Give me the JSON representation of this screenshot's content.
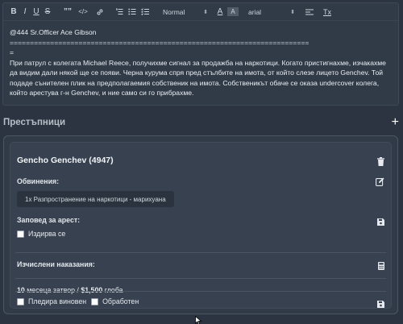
{
  "toolbar": {
    "bold": "B",
    "italic": "I",
    "underline": "U",
    "strike": "S",
    "quote": "””",
    "code": "</>",
    "heading_select": "Normal",
    "font_select": "arial",
    "text_color": "A",
    "bg_color": "A",
    "clear_format": "Tx"
  },
  "editor": {
    "line1": "@444 Sr.Officer Ace Gibson",
    "separator": "==========================================================================",
    "separator_end": "=",
    "paragraph": "При патрул с колегата Michael Reece, получихме сигнал за продажба на наркотици. Когато пристигнахме, изчакахме да видим дали някой ще се появи. Черна курума спря пред стълбите на имота, от който слезе лицето Genchev. Той подаде сънителен плик на предполагаемия собственик на имота. Собственикът обаче се оказа undercover колега, който арестува г-н Genchev, и ние само си го прибрахме."
  },
  "section": {
    "title": "Престъпници"
  },
  "suspect": {
    "name": "Gencho Genchev (4947)",
    "charges_label": "Обвинения:",
    "charge_item": "1x Разпространение на наркотици - марихуана",
    "warrant_label": "Заповед за арест:",
    "wanted_label": "Издирва се",
    "penalties_label": "Изчислени наказания:",
    "prison": "10",
    "prison_unit": "месеца затвор /",
    "fine": "$1,500",
    "fine_unit": "глоба",
    "guilty_label": "Пледира виновен",
    "processed_label": "Обработен"
  }
}
